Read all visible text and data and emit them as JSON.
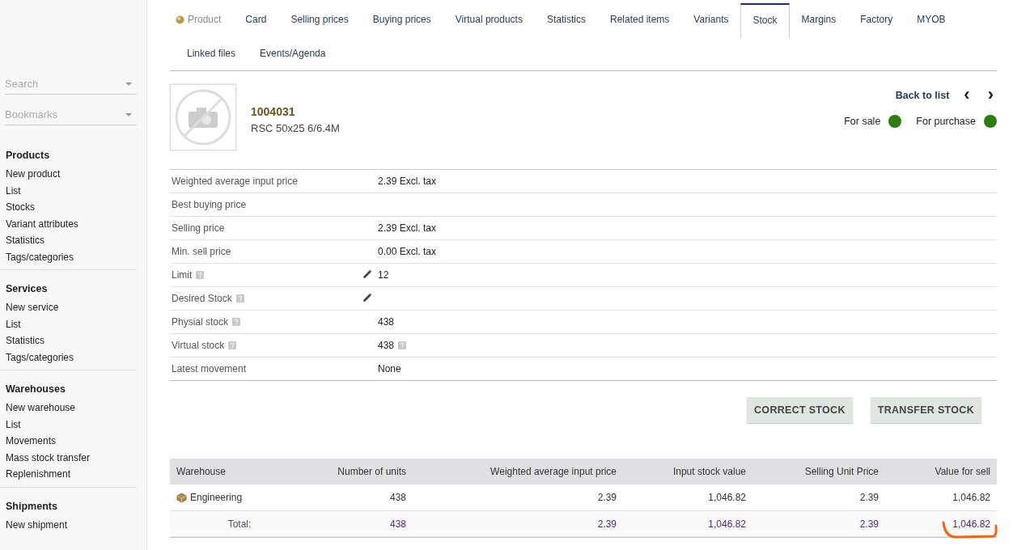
{
  "sidebar": {
    "search": {
      "placeholder": "Search"
    },
    "bookmarks": {
      "placeholder": "Bookmarks"
    },
    "sections": [
      {
        "title": "Products",
        "items": [
          "New product",
          "List",
          "Stocks",
          "Variant attributes",
          "Statistics",
          "Tags/categories"
        ]
      },
      {
        "title": "Services",
        "items": [
          "New service",
          "List",
          "Statistics",
          "Tags/categories"
        ]
      },
      {
        "title": "Warehouses",
        "items": [
          "New warehouse",
          "List",
          "Movements",
          "Mass stock transfer",
          "Replenishment"
        ]
      },
      {
        "title": "Shipments",
        "items": [
          "New shipment"
        ]
      }
    ]
  },
  "tabs": [
    {
      "label": "Product",
      "kind": "module",
      "selected": false
    },
    {
      "label": "Card",
      "kind": "tab",
      "selected": false
    },
    {
      "label": "Selling prices",
      "kind": "tab",
      "selected": false
    },
    {
      "label": "Buying prices",
      "kind": "tab",
      "selected": false
    },
    {
      "label": "Virtual products",
      "kind": "tab",
      "selected": false
    },
    {
      "label": "Statistics",
      "kind": "tab",
      "selected": false
    },
    {
      "label": "Related items",
      "kind": "tab",
      "selected": false
    },
    {
      "label": "Variants",
      "kind": "tab",
      "selected": false
    },
    {
      "label": "Stock",
      "kind": "tab",
      "selected": true
    },
    {
      "label": "Margins",
      "kind": "tab",
      "selected": false
    },
    {
      "label": "Factory",
      "kind": "tab",
      "selected": false
    },
    {
      "label": "MYOB",
      "kind": "tab",
      "selected": false
    },
    {
      "label": "Linked files",
      "kind": "tab",
      "selected": false
    },
    {
      "label": "Events/Agenda",
      "kind": "tab",
      "selected": false
    }
  ],
  "product": {
    "ref": "1004031",
    "name": "RSC 50x25 6/6.4M",
    "back_link": "Back to list",
    "prev": "‹",
    "next": "›",
    "statuses": [
      {
        "label": "For sale",
        "color": "#2f7d10"
      },
      {
        "label": "For purchase",
        "color": "#2f7d10"
      }
    ]
  },
  "fields": [
    {
      "label": "Weighted average input price",
      "help": false,
      "editable": false,
      "value": "2.39 Excl. tax",
      "value_help": false
    },
    {
      "label": "Best buying price",
      "help": false,
      "editable": false,
      "value_help": false
    },
    {
      "label": "Selling price",
      "help": false,
      "editable": false,
      "value": "2.39 Excl. tax",
      "value_help": false
    },
    {
      "label": "Min. sell price",
      "help": false,
      "editable": false,
      "value": "0.00 Excl. tax",
      "value_help": false
    },
    {
      "label": "Limit",
      "help": true,
      "editable": true,
      "value": "12",
      "value_help": false
    },
    {
      "label": "Desired Stock",
      "help": true,
      "editable": true,
      "value_help": false
    },
    {
      "label": "Physial stock",
      "help": true,
      "editable": false,
      "value": "438",
      "value_help": false
    },
    {
      "label": "Virtual stock",
      "help": true,
      "editable": false,
      "value": "438",
      "value_help": true
    },
    {
      "label": "Latest movement",
      "help": false,
      "editable": false,
      "value": "None",
      "value_help": false
    }
  ],
  "actions": [
    "CORRECT STOCK",
    "TRANSFER STOCK"
  ],
  "stock_table": {
    "columns": [
      "Warehouse",
      "Number of units",
      "Weighted average input price",
      "Input stock value",
      "Selling Unit Price",
      "Value for sell"
    ],
    "rows": [
      {
        "kind": "item",
        "cells": [
          "Engineering",
          "438",
          "2.39",
          "1,046.82",
          "2.39",
          "1,046.82"
        ]
      },
      {
        "kind": "total",
        "cells": [
          "Total:",
          "438",
          "2.39",
          "1,046.82",
          "2.39",
          "1,046.82"
        ]
      }
    ]
  }
}
